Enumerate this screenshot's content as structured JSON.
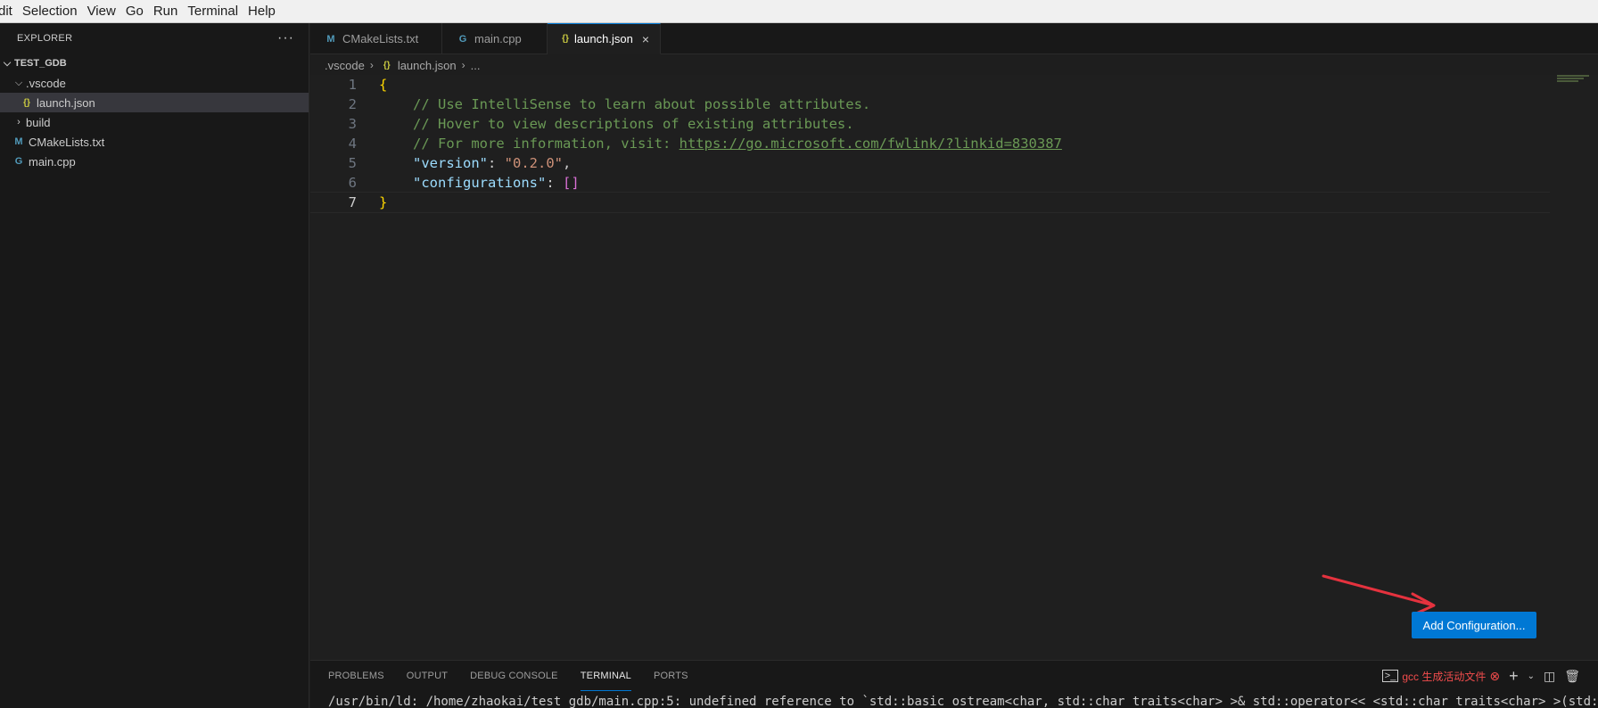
{
  "menubar": {
    "items": [
      "dit",
      "Selection",
      "View",
      "Go",
      "Run",
      "Terminal",
      "Help"
    ]
  },
  "explorer": {
    "title": "EXPLORER",
    "more_actions": "···",
    "root": "TEST_GDB",
    "items": [
      {
        "label": ".vscode",
        "type": "folder",
        "expanded": true
      },
      {
        "label": "launch.json",
        "type": "json",
        "icon_text": "{}"
      },
      {
        "label": "build",
        "type": "folder",
        "expanded": false
      },
      {
        "label": "CMakeLists.txt",
        "type": "cmake",
        "icon_text": "M"
      },
      {
        "label": "main.cpp",
        "type": "cpp",
        "icon_text": "G"
      }
    ]
  },
  "tabs": [
    {
      "label": "CMakeLists.txt",
      "icon_text": "M",
      "active": false
    },
    {
      "label": "main.cpp",
      "icon_text": "G",
      "active": false
    },
    {
      "label": "launch.json",
      "icon_text": "{}",
      "active": true,
      "close": "×"
    }
  ],
  "breadcrumb": {
    "folder": ".vscode",
    "file_icon": "{}",
    "file": "launch.json",
    "more": "..."
  },
  "editor": {
    "lines": [
      {
        "num": "1"
      },
      {
        "num": "2",
        "comment": "// Use IntelliSense to learn about possible attributes."
      },
      {
        "num": "3",
        "comment": "// Hover to view descriptions of existing attributes."
      },
      {
        "num": "4",
        "comment": "// For more information, visit: ",
        "link": "https://go.microsoft.com/fwlink/?linkid=830387"
      },
      {
        "num": "5",
        "key": "\"version\"",
        "colon": ": ",
        "value": "\"0.2.0\"",
        "tail": ","
      },
      {
        "num": "6",
        "key": "\"configurations\"",
        "colon": ": ",
        "value": "[]"
      },
      {
        "num": "7"
      }
    ],
    "open_brace": "{",
    "close_brace": "}"
  },
  "add_configuration_button": "Add Configuration...",
  "panel": {
    "tabs": [
      "PROBLEMS",
      "OUTPUT",
      "DEBUG CONSOLE",
      "TERMINAL",
      "PORTS"
    ],
    "active_tab": "TERMINAL",
    "terminal_name": "gcc 生成活动文件",
    "terminal_output": "/usr/bin/ld: /home/zhaokai/test_gdb/main.cpp:5: undefined reference to `std::basic_ostream<char, std::char_traits<char> >& std::operator<< <std::char_traits<char> >(std::basic"
  },
  "colors": {
    "accent": "#0078d4",
    "arrow": "#e5323e"
  }
}
